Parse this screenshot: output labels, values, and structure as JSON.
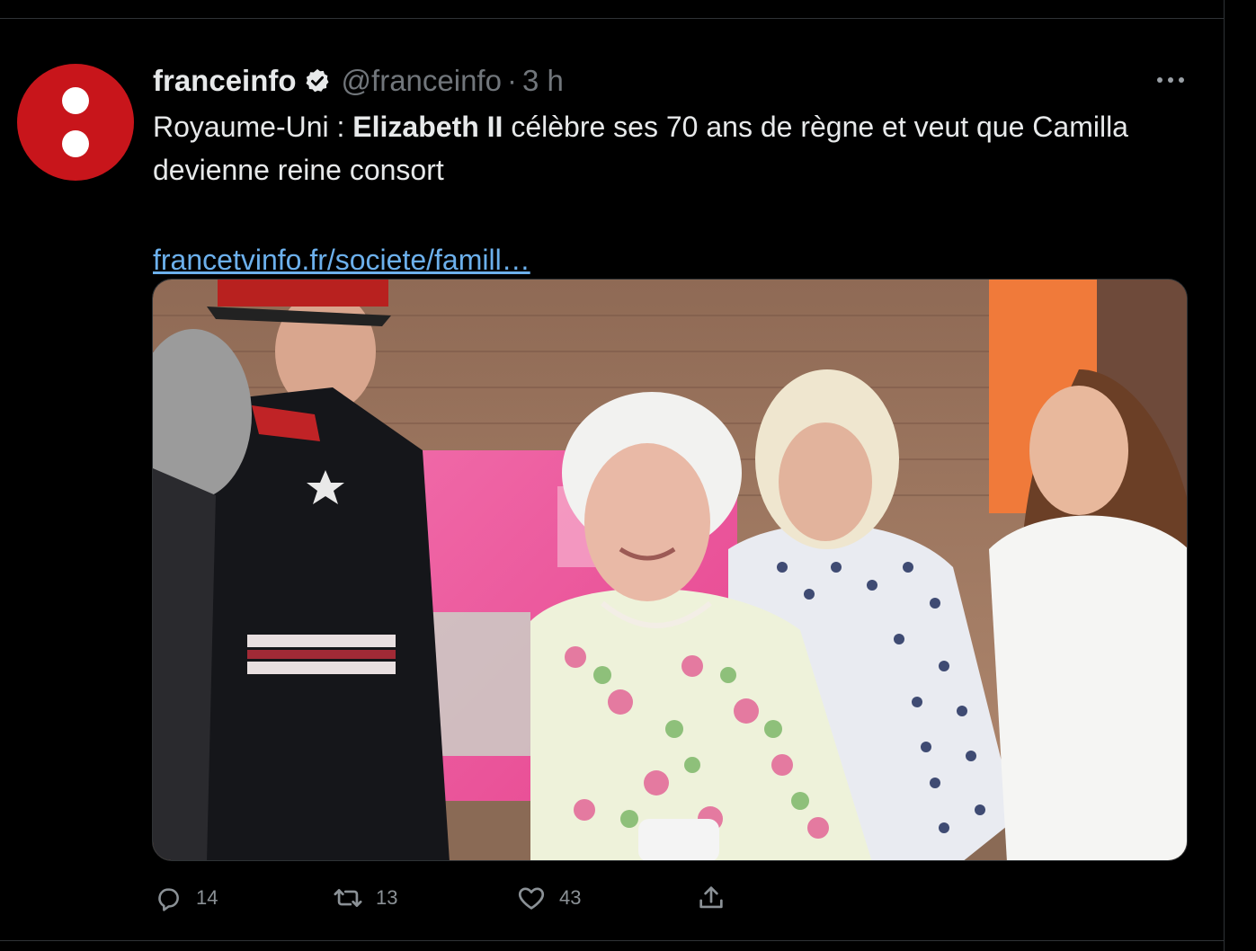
{
  "tweet": {
    "author_name": "franceinfo",
    "author_handle": "@franceinfo",
    "separator": "·",
    "time": "3 h",
    "text_prefix": "Royaume-Uni : ",
    "text_bold": "Elizabeth II",
    "text_suffix": " célèbre ses 70 ans de règne et veut que Camilla devienne reine consort",
    "link": "francetvinfo.fr/societe/famill…",
    "stats": {
      "replies": "14",
      "retweets": "13",
      "likes": "43"
    }
  },
  "icons": {
    "verified": "verified-badge-icon",
    "more": "more-icon",
    "reply": "reply-icon",
    "retweet": "retweet-icon",
    "like": "heart-icon",
    "share": "share-icon"
  },
  "colors": {
    "background": "#000000",
    "text": "#e7e9ea",
    "muted": "#71767b",
    "link": "#6cb0ec",
    "avatar": "#c8151b"
  }
}
